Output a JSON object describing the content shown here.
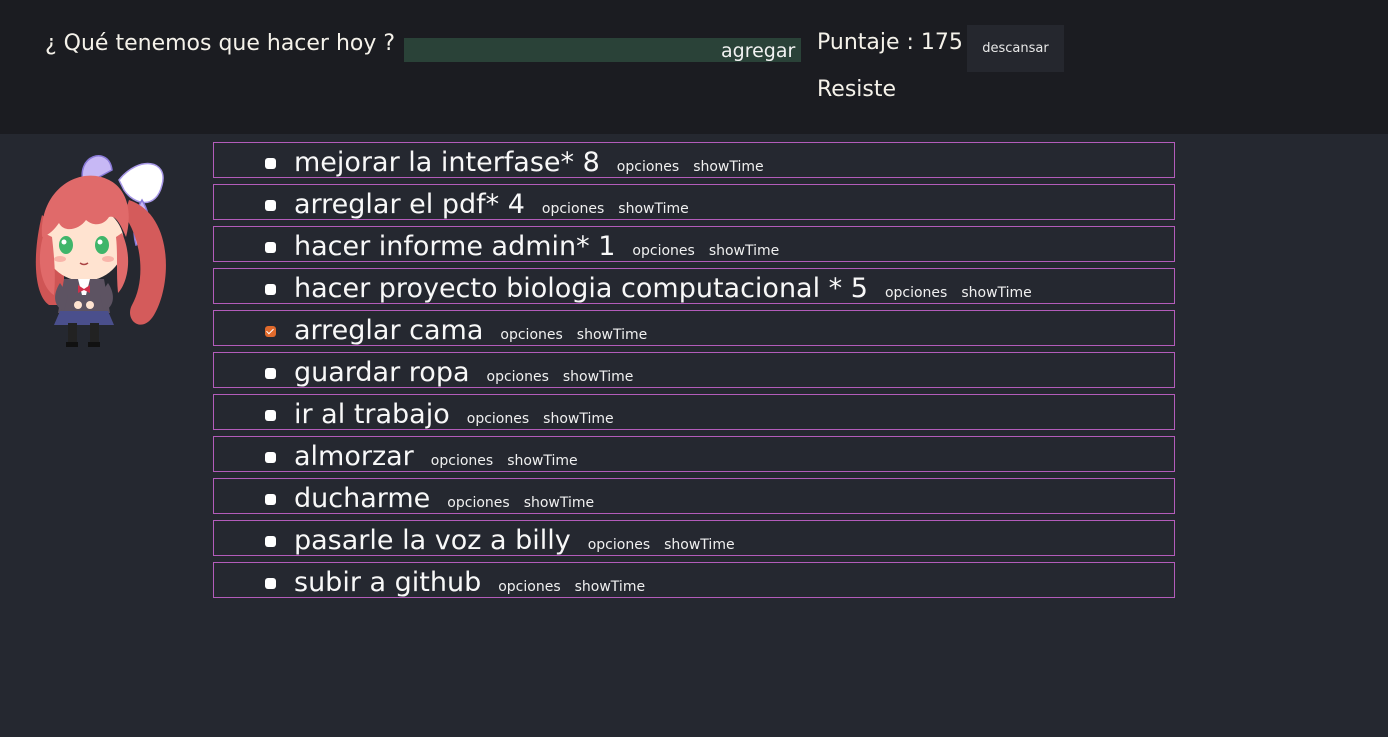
{
  "header": {
    "prompt": "¿ Qué tenemos que hacer hoy ?",
    "input_value": "",
    "add_label": "agregar",
    "score_label": "Puntaje : 175",
    "rest_label": "descansar",
    "status": "Resiste"
  },
  "tasks": [
    {
      "name": "mejorar la interfase* 8",
      "checked": false
    },
    {
      "name": "arreglar el pdf* 4",
      "checked": false
    },
    {
      "name": "hacer informe admin* 1",
      "checked": false
    },
    {
      "name": "hacer proyecto biologia computacional * 5",
      "checked": false
    },
    {
      "name": "arreglar cama",
      "checked": true
    },
    {
      "name": "guardar ropa",
      "checked": false
    },
    {
      "name": "ir al trabajo",
      "checked": false
    },
    {
      "name": "almorzar",
      "checked": false
    },
    {
      "name": "ducharme",
      "checked": false
    },
    {
      "name": "pasarle la voz a billy",
      "checked": false
    },
    {
      "name": "subir a github",
      "checked": false
    }
  ],
  "task_links": {
    "options_label": "opciones",
    "showtime_label": "showTime"
  },
  "colors": {
    "background": "#252830",
    "header_bg": "#1b1c21",
    "task_border": "#b35cba",
    "input_bg": "#2a4238",
    "checkbox_checked": "#e06a2c"
  },
  "icons": {
    "avatar": "anime-girl-avatar",
    "checkbox": "checkbox-icon"
  }
}
